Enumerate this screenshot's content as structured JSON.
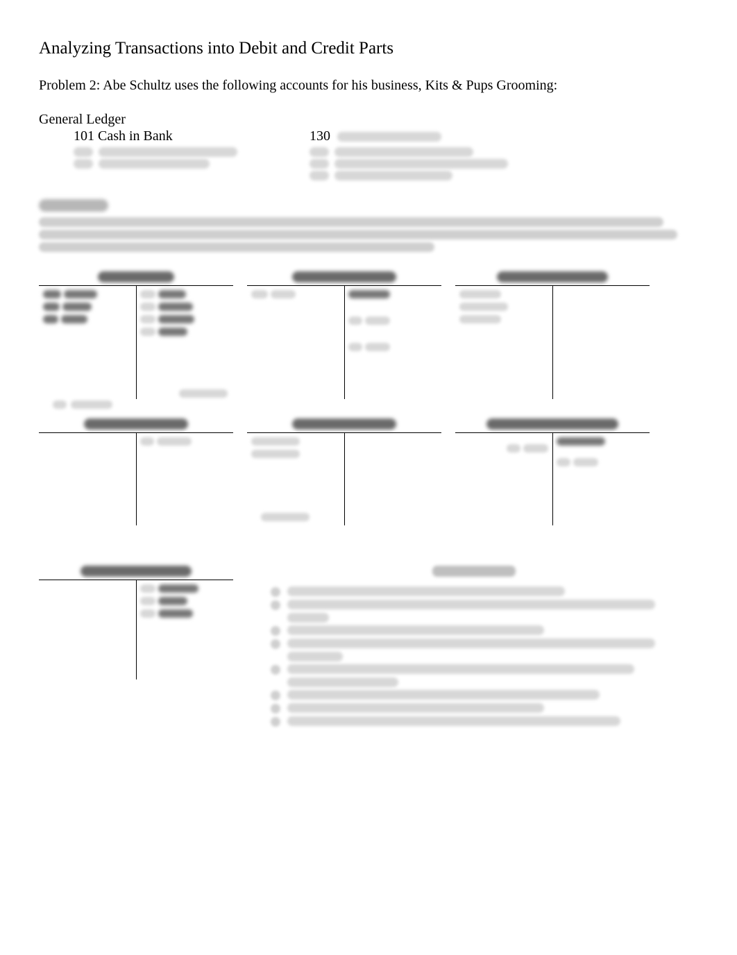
{
  "title": "Analyzing Transactions into Debit and Credit Parts",
  "problem_intro": "Problem 2: Abe Schultz uses the following accounts for his business, Kits & Pups Grooming:",
  "ledger_header": "General Ledger",
  "ledger_left": [
    {
      "num": "101",
      "name": "Cash in Bank",
      "visible": true
    },
    {
      "num": "",
      "name": "",
      "visible": false
    },
    {
      "num": "",
      "name": "",
      "visible": false
    }
  ],
  "ledger_right": [
    {
      "num": "130",
      "name": "",
      "visible_num": true,
      "visible_name": false
    },
    {
      "num": "",
      "name": "",
      "visible": false
    },
    {
      "num": "",
      "name": "",
      "visible": false
    },
    {
      "num": "",
      "name": "",
      "visible": false
    }
  ],
  "t_accounts_row1": [
    {
      "id": "tacc-1"
    },
    {
      "id": "tacc-2"
    },
    {
      "id": "tacc-3"
    }
  ],
  "t_accounts_row2": [
    {
      "id": "tacc-4"
    },
    {
      "id": "tacc-5"
    },
    {
      "id": "tacc-6"
    }
  ],
  "t_account_bottom": {
    "id": "tacc-7"
  }
}
